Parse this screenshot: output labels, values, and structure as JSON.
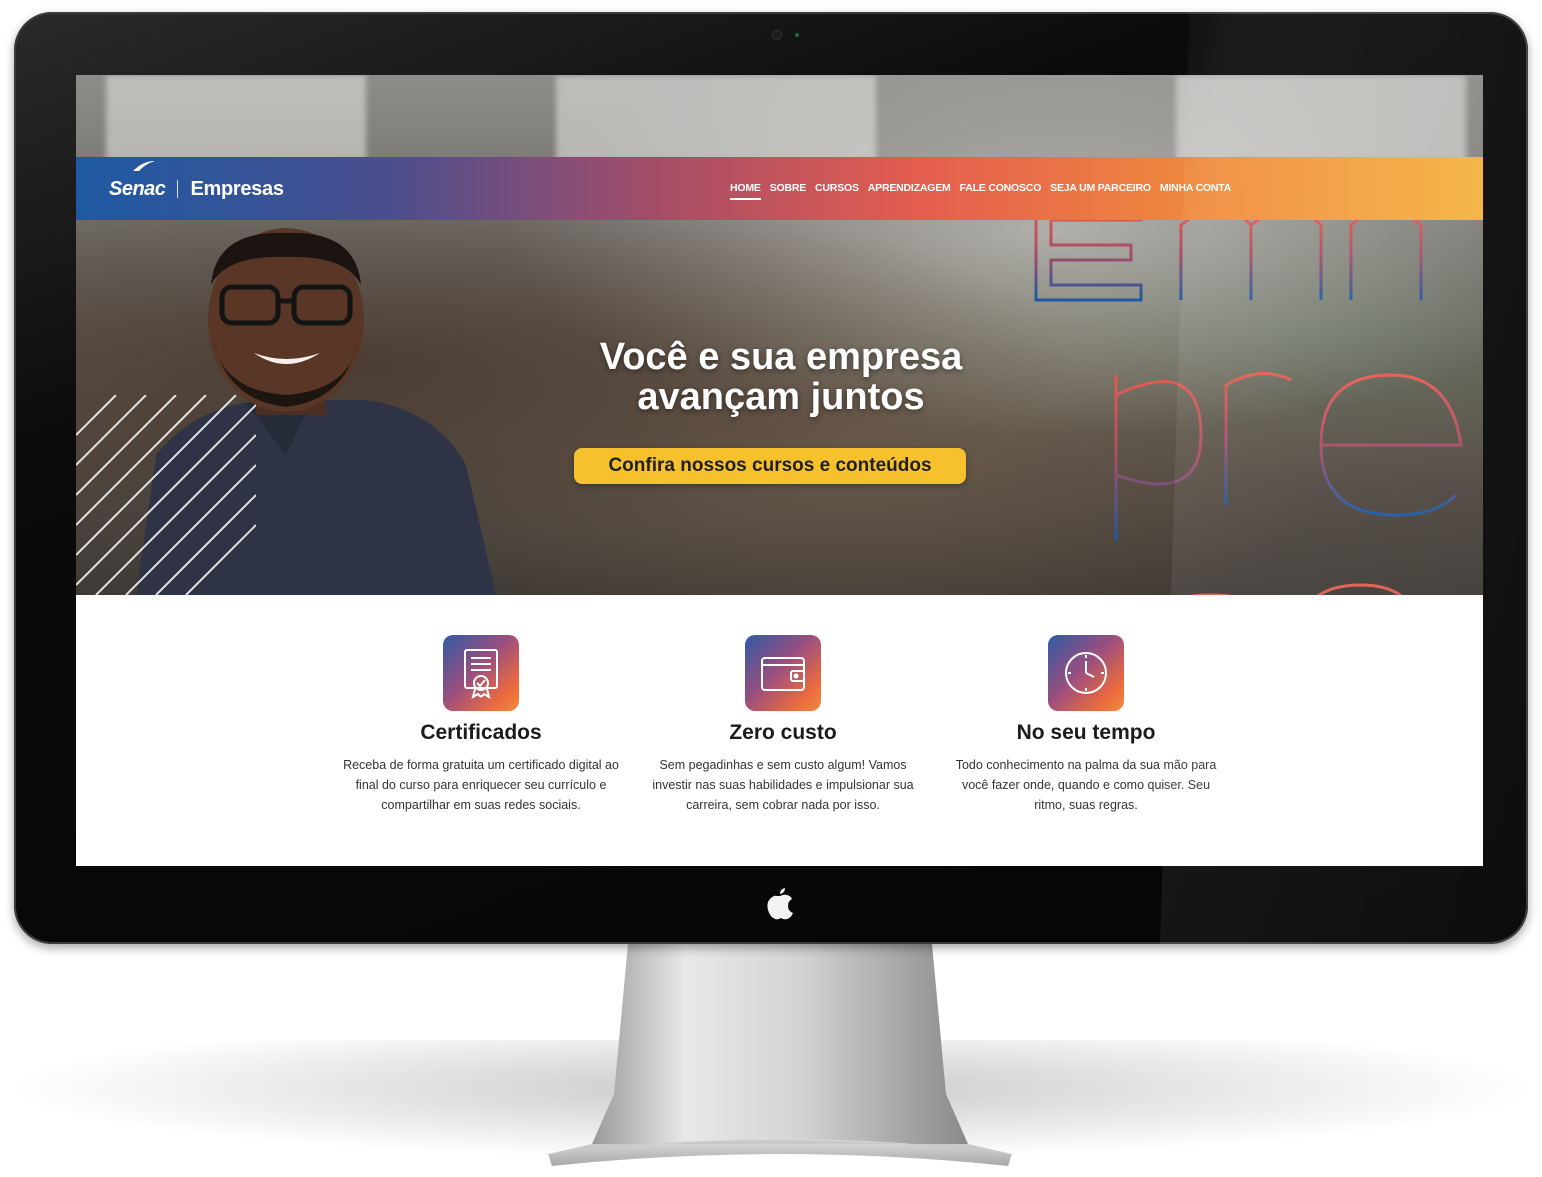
{
  "site": {
    "brand_logo": "Senac",
    "brand_name": "Empresas"
  },
  "nav": {
    "items": [
      {
        "label": "HOME",
        "active": true
      },
      {
        "label": "SOBRE"
      },
      {
        "label": "CURSOS"
      },
      {
        "label": "APRENDIZAGEM"
      },
      {
        "label": "FALE CONOSCO"
      },
      {
        "label": "SEJA UM PARCEIRO"
      },
      {
        "label": "MINHA CONTA"
      }
    ]
  },
  "hero": {
    "title_line1": "Você e sua empresa",
    "title_line2": "avançam juntos",
    "cta_label": "Confira nossos cursos e conteúdos",
    "background_word": "Empresa"
  },
  "features": [
    {
      "icon": "certificate-icon",
      "title": "Certificados",
      "text": "Receba de forma gratuita um certificado digital ao final do curso para enriquecer seu currículo e compartilhar em suas redes sociais."
    },
    {
      "icon": "wallet-icon",
      "title": "Zero custo",
      "text": "Sem pegadinhas e sem custo algum! Vamos investir nas suas habilidades e impulsionar sua carreira, sem cobrar nada por isso."
    },
    {
      "icon": "clock-icon",
      "title": "No seu tempo",
      "text": "Todo conhecimento na palma da sua mão para você fazer onde, quando e como quiser. Seu ritmo, suas regras."
    }
  ],
  "colors": {
    "cta": "#f7c12d",
    "nav_start": "#1d5aa3",
    "nav_end": "#f5b340"
  }
}
